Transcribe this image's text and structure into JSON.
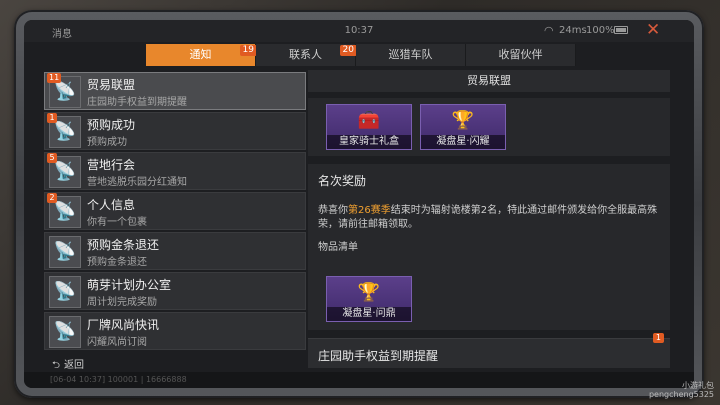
{
  "statusbar": {
    "left_label": "消息",
    "time": "10:37",
    "ping": "24ms",
    "battery": "100%"
  },
  "tabs": [
    {
      "label": "通知",
      "badge": "19"
    },
    {
      "label": "联系人",
      "badge": "20"
    },
    {
      "label": "巡猎车队",
      "badge": ""
    },
    {
      "label": "收留伙伴",
      "badge": ""
    }
  ],
  "list": [
    {
      "title": "贸易联盟",
      "sub": "庄园助手权益到期提醒",
      "badge": "11",
      "icon": "satellite-dish-icon"
    },
    {
      "title": "预购成功",
      "sub": "预购成功",
      "badge": "1",
      "icon": "satellite-dish-icon"
    },
    {
      "title": "营地行会",
      "sub": "营地逃脱乐园分红通知",
      "badge": "5",
      "icon": "satellite-dish-icon"
    },
    {
      "title": "个人信息",
      "sub": "你有一个包裹",
      "badge": "2",
      "icon": "satellite-dish-icon"
    },
    {
      "title": "预购金条退还",
      "sub": "预购金条退还",
      "badge": "",
      "icon": "satellite-dish-icon"
    },
    {
      "title": "萌芽计划办公室",
      "sub": "周计划完成奖励",
      "badge": "",
      "icon": "satellite-dish-icon"
    },
    {
      "title": "厂牌风尚快讯",
      "sub": "闪耀风尚订阅",
      "badge": "",
      "icon": "satellite-dish-icon"
    }
  ],
  "back_label": "返回",
  "bottom_info": "[06-04 10:37] 100001 | 16666888",
  "panel": {
    "header": "贸易联盟",
    "top_items": [
      {
        "label": "皇家骑士礼盒"
      },
      {
        "label": "凝盘星·闪耀"
      }
    ],
    "reward_title": "名次奖励",
    "reward_text_pre": "恭喜你",
    "reward_text_hl": "第26赛季",
    "reward_text_post": "结束时为辐射诡楼第2名，特此通过邮件颁发给你全服最高殊荣，请前往邮箱领取。",
    "reward_list_title": "物品清单",
    "reward_items": [
      {
        "label": "凝盘星·问鼎"
      }
    ],
    "notice2_title": "庄园助手权益到期提醒",
    "notice2_badge": "1"
  },
  "watermark": {
    "line1": "小游礼包",
    "line2": "pengcheng5325"
  },
  "colors": {
    "accent": "#e8872c",
    "badge": "#e05b22",
    "item_purple": "#5b3f8a"
  }
}
